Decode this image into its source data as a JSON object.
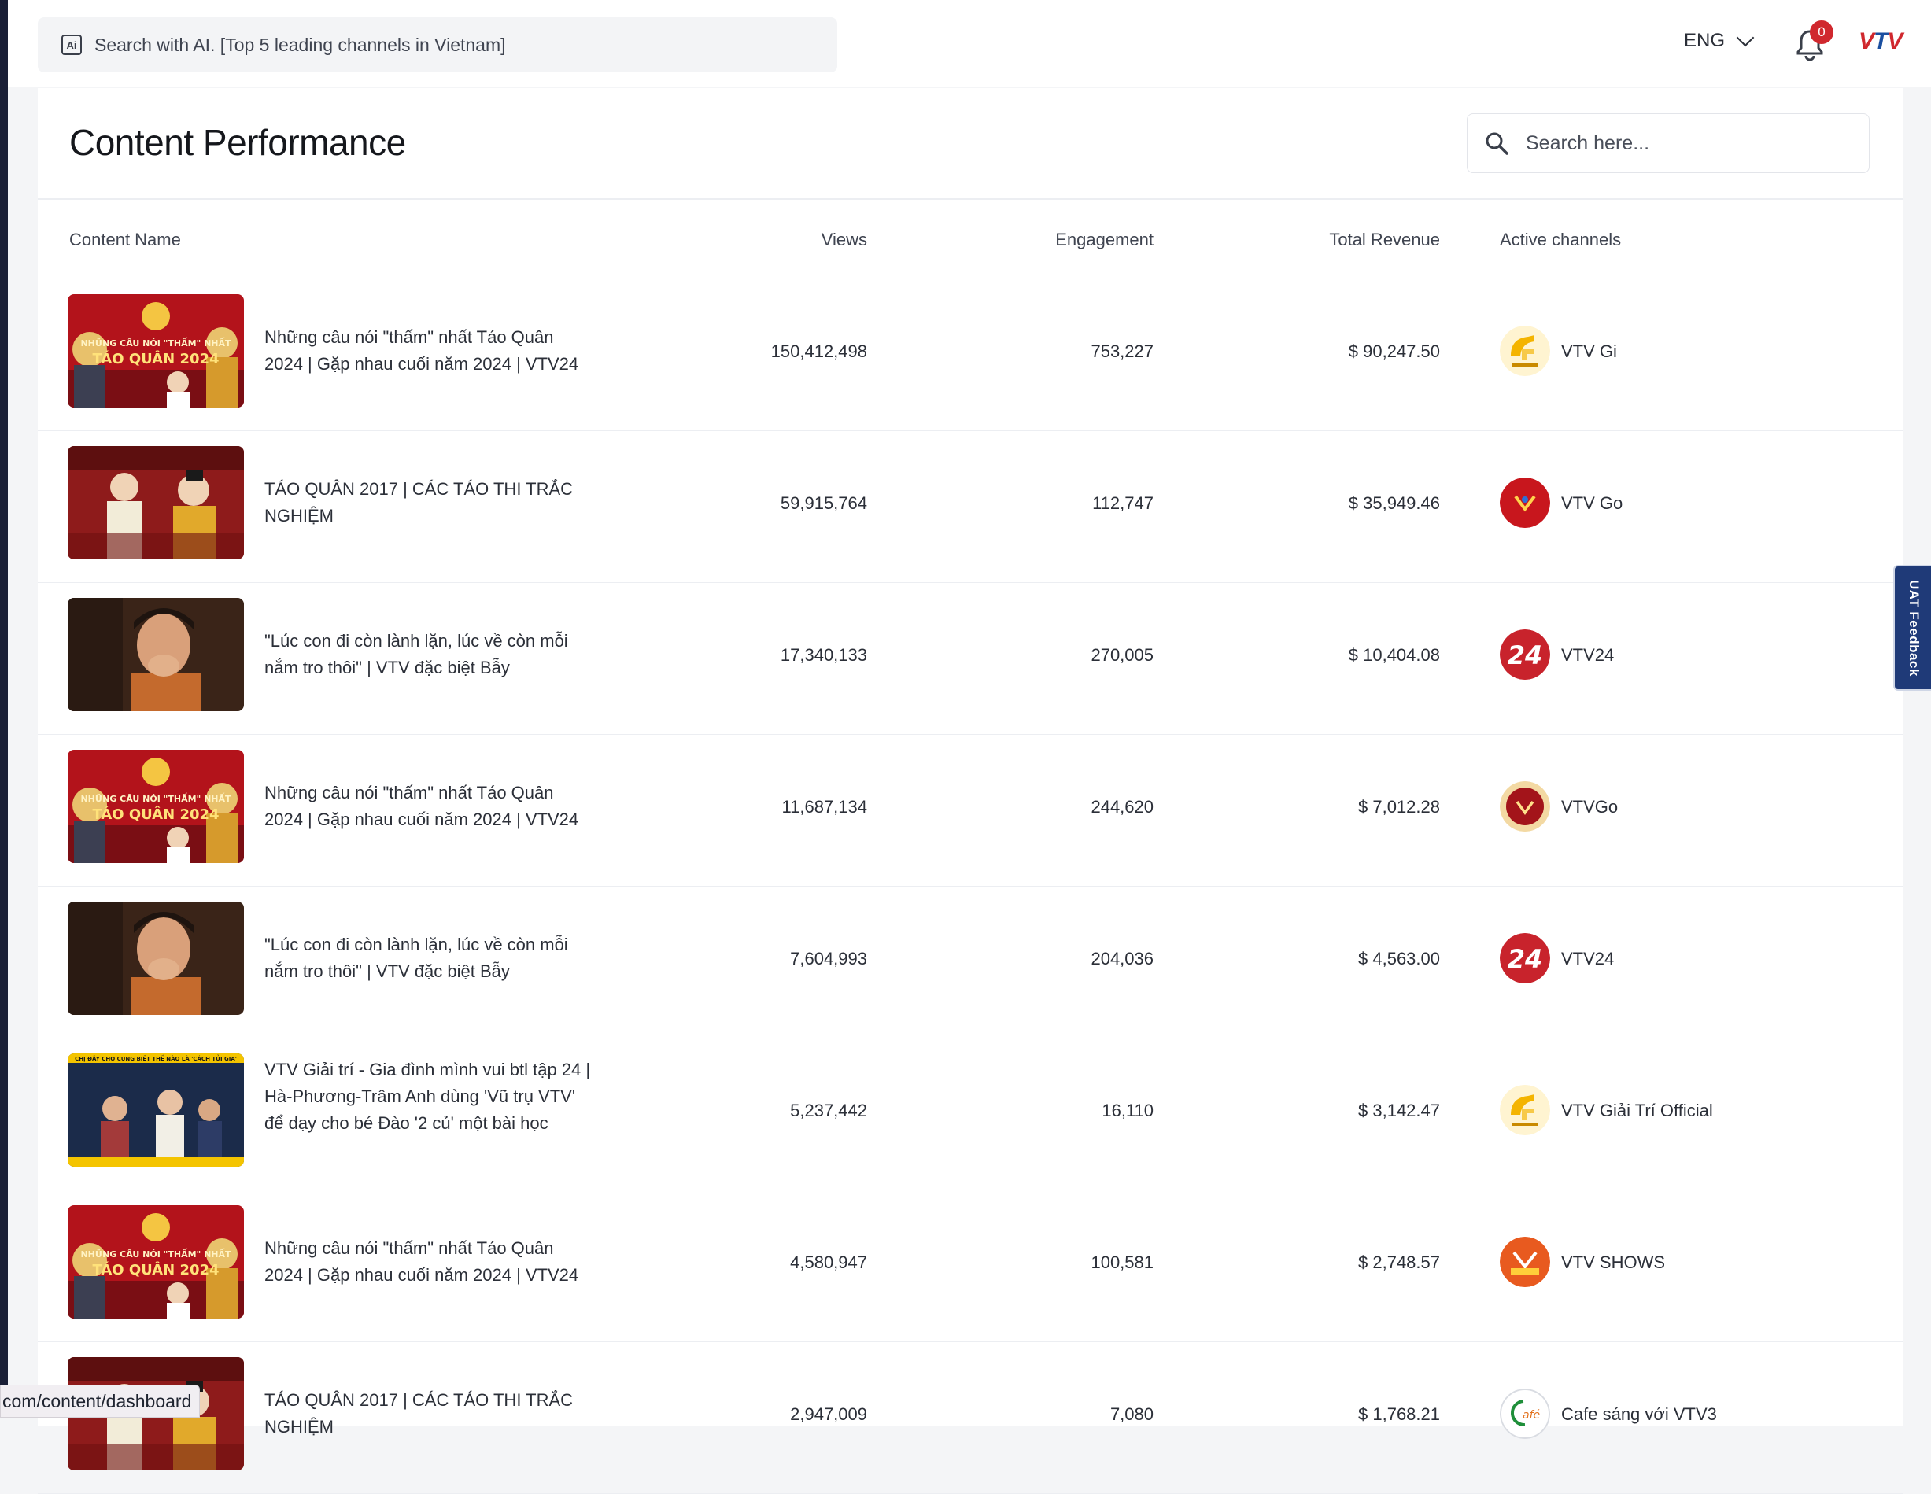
{
  "topbar": {
    "ai_search_text": "Search with AI. [Top 5 leading channels in Vietnam]",
    "language": "ENG",
    "notification_count": "0",
    "brand_parts": [
      "V",
      "T",
      "V"
    ]
  },
  "page": {
    "title": "Content Performance",
    "search_placeholder": "Search here..."
  },
  "table": {
    "headers": {
      "content_name": "Content Name",
      "views": "Views",
      "engagement": "Engagement",
      "total_revenue": "Total Revenue",
      "active_channels": "Active channels"
    },
    "rows": [
      {
        "title": "Những câu nói \"thấm\" nhất Táo Quân 2024 | Gặp nhau cuối năm 2024 | VTV24",
        "views": "150,412,498",
        "engagement": "753,227",
        "revenue": "$ 90,247.50",
        "channel": "VTV Gi",
        "thumb": "tao-quan-2024",
        "logo": "vtv-gi"
      },
      {
        "title": "TÁO QUÂN 2017 | CÁC TÁO THI TRẮC NGHIỆM",
        "views": "59,915,764",
        "engagement": "112,747",
        "revenue": "$ 35,949.46",
        "channel": "VTV Go",
        "thumb": "tao-quan-2017",
        "logo": "vtv-go"
      },
      {
        "title": "\"Lúc con đi còn lành lặn, lúc về còn mỗi nắm tro thôi\" | VTV đặc biệt Bẫy",
        "views": "17,340,133",
        "engagement": "270,005",
        "revenue": "$ 10,404.08",
        "channel": "VTV24",
        "thumb": "woman-crying",
        "logo": "vtv24"
      },
      {
        "title": "Những câu nói \"thấm\" nhất Táo Quân 2024 | Gặp nhau cuối năm 2024 | VTV24",
        "views": "11,687,134",
        "engagement": "244,620",
        "revenue": "$ 7,012.28",
        "channel": "VTVGo",
        "thumb": "tao-quan-2024",
        "logo": "vtvgo-alt"
      },
      {
        "title": "\"Lúc con đi còn lành lặn, lúc về còn mỗi nắm tro thôi\" | VTV đặc biệt Bẫy",
        "views": "7,604,993",
        "engagement": "204,036",
        "revenue": "$ 4,563.00",
        "channel": "VTV24",
        "thumb": "woman-crying",
        "logo": "vtv24"
      },
      {
        "title": "VTV Giải trí - Gia đình mình vui btl tập 24 | Hà-Phương-Trâm Anh dùng 'Vũ trụ VTV' để dạy cho bé Đào '2 củ' một bài học",
        "views": "5,237,442",
        "engagement": "16,110",
        "revenue": "$ 3,142.47",
        "channel": "VTV Giải Trí Official",
        "thumb": "gia-dinh",
        "logo": "vtv-gi"
      },
      {
        "title": "Những câu nói \"thấm\" nhất Táo Quân 2024 | Gặp nhau cuối năm 2024 | VTV24",
        "views": "4,580,947",
        "engagement": "100,581",
        "revenue": "$ 2,748.57",
        "channel": "VTV SHOWS",
        "thumb": "tao-quan-2024",
        "logo": "vtv-shows"
      },
      {
        "title": "TÁO QUÂN 2017 | CÁC TÁO THI TRẮC NGHIỆM",
        "views": "2,947,009",
        "engagement": "7,080",
        "revenue": "$ 1,768.21",
        "channel": "Cafe sáng với VTV3",
        "thumb": "tao-quan-2017",
        "logo": "cafe-sang"
      }
    ]
  },
  "thumb_text": {
    "tao_quan_2024_line1": "NHỮNG CÂU NÓI \"THẤM\" NHẤT",
    "tao_quan_2024_line2": "TÁO QUÂN 2024",
    "gia_dinh_banner": "CHỊ ĐÂY CHO CUNG BIẾT THẾ NÀO LÀ 'CÁCH TỬI GIA'"
  },
  "logo_text": {
    "vtv24": "24",
    "cafe": "afé"
  },
  "feedback_tab": "UAT Feedback",
  "status_url": "com/content/dashboard",
  "colors": {
    "brand_red": "#d0282e",
    "brand_blue": "#1a4fa0",
    "feedback_bg": "#1f3a78"
  }
}
